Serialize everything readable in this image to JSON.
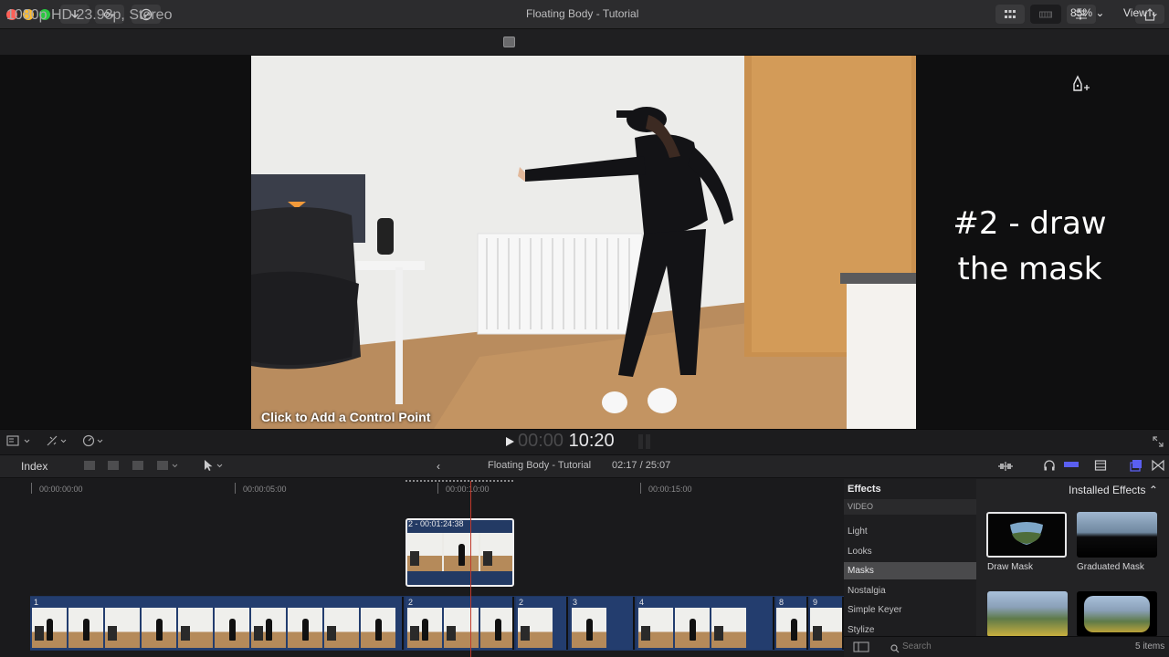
{
  "colors": {
    "accent": "#5a5ff0",
    "playhead": "#c0392b",
    "clip_blue": "#233d6e",
    "traffic_red": "#fe5f57",
    "traffic_yellow": "#febc2e",
    "traffic_green": "#28c840"
  },
  "viewer": {
    "format": "1080p HD 23.98p, Stereo",
    "title": "Floating Body - Tutorial",
    "zoom": "85% ⌄",
    "view_menu": "View ⌄",
    "overlay_line1": "#2 - draw",
    "overlay_line2": "the mask",
    "control_hint": "Click to Add a Control Point"
  },
  "transport": {
    "timecode_dim": "00:00",
    "timecode": "10:20"
  },
  "timeline": {
    "index_label": "Index",
    "project_name": "Floating Body - Tutorial",
    "project_time": "02:17 / 25:07",
    "ruler": [
      "00:00:00:00",
      "00:00:05:00",
      "00:00:10:00",
      "00:00:15:00"
    ],
    "connected_clip_label": "2 - 00:01:24:38",
    "clip_numbers": [
      "1",
      "2",
      "2",
      "3",
      "4",
      "8",
      "9"
    ]
  },
  "effects": {
    "header": "Effects",
    "category_group": "VIDEO",
    "categories": [
      "Light",
      "Looks",
      "Masks",
      "Nostalgia",
      "Simple Keyer",
      "Stylize"
    ],
    "selected_category": "Masks",
    "installed_label": "Installed Effects ⌃",
    "items": [
      "Draw Mask",
      "Graduated Mask"
    ],
    "search_placeholder": "Search",
    "items_count": "5 items"
  },
  "icons": [
    "download-icon",
    "key-icon",
    "checkmark-icon",
    "grid-icon",
    "filmstrip-icon",
    "sliders-icon",
    "share-icon",
    "pen-add-icon",
    "play-icon",
    "fullscreen-icon",
    "arrow-tool-icon",
    "headphones-icon",
    "search-icon"
  ]
}
